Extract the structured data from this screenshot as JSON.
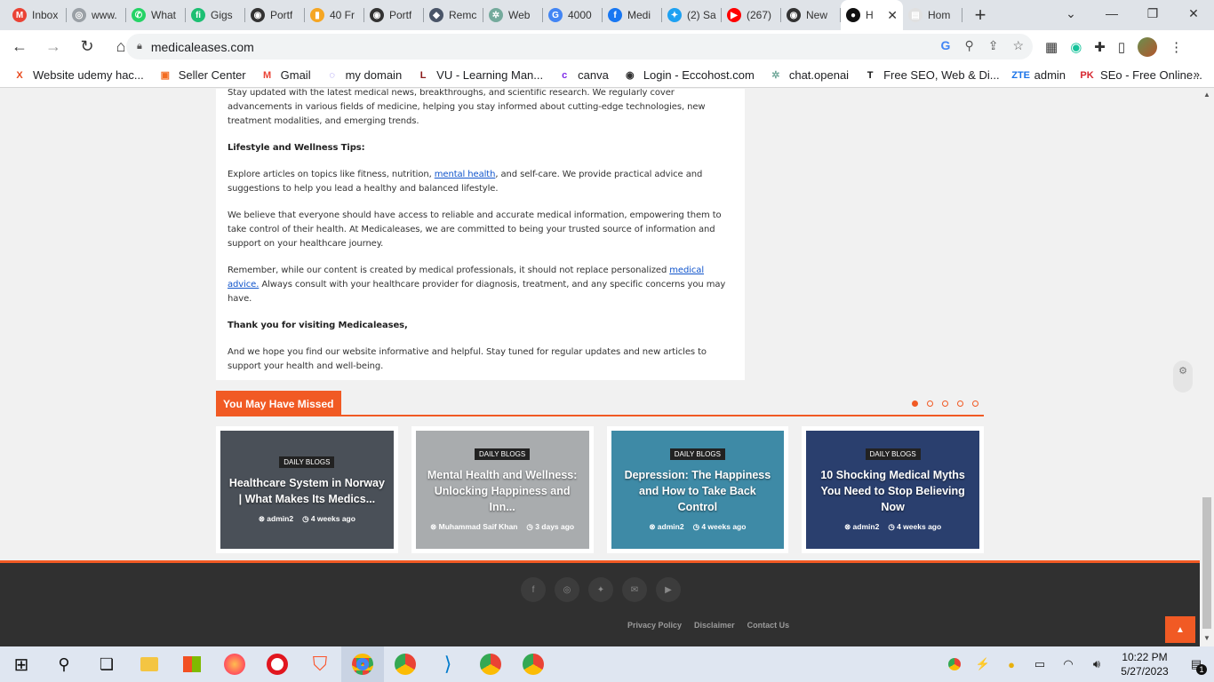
{
  "browser": {
    "tabs": [
      {
        "title": "Inbox",
        "icon": "gmail-icon",
        "color": "#ea4335",
        "glyph": "M"
      },
      {
        "title": "www.",
        "icon": "globe-icon",
        "color": "#9aa0a6",
        "glyph": "◎"
      },
      {
        "title": "What",
        "icon": "whatsapp-icon",
        "color": "#25d366",
        "glyph": "✆"
      },
      {
        "title": "Gigs",
        "icon": "fiverr-icon",
        "color": "#1dbf73",
        "glyph": "fi"
      },
      {
        "title": "Portf",
        "icon": "globe-icon",
        "color": "#333333",
        "glyph": "◉"
      },
      {
        "title": "40 Fr",
        "icon": "chart-icon",
        "color": "#f5a623",
        "glyph": "▮"
      },
      {
        "title": "Portf",
        "icon": "globe-icon",
        "color": "#333333",
        "glyph": "◉"
      },
      {
        "title": "Remc",
        "icon": "layers-icon",
        "color": "#4a5568",
        "glyph": "◆"
      },
      {
        "title": "Web",
        "icon": "openai-icon",
        "color": "#74aa9c",
        "glyph": "✲"
      },
      {
        "title": "4000",
        "icon": "google-icon",
        "color": "#4285f4",
        "glyph": "G"
      },
      {
        "title": "Medi",
        "icon": "facebook-icon",
        "color": "#1877f2",
        "glyph": "f"
      },
      {
        "title": "(2) Sa",
        "icon": "twitter-icon",
        "color": "#1da1f2",
        "glyph": "✦"
      },
      {
        "title": "(267)",
        "icon": "youtube-icon",
        "color": "#ff0000",
        "glyph": "▶"
      },
      {
        "title": "New",
        "icon": "chrome-icon",
        "color": "#333333",
        "glyph": "◉"
      },
      {
        "title": "H",
        "icon": "site-icon",
        "color": "#111111",
        "glyph": "●",
        "active": true
      },
      {
        "title": "Hom",
        "icon": "page-icon",
        "color": "#e0e0e0",
        "glyph": "▤"
      }
    ],
    "url": "medicaleases.com",
    "bookmarks": [
      {
        "label": "Website udemy hac...",
        "icon": "x-icon",
        "color": "#e8491d",
        "glyph": "X"
      },
      {
        "label": "Seller Center",
        "icon": "store-icon",
        "color": "#f36c21",
        "glyph": "▣"
      },
      {
        "label": "Gmail",
        "icon": "gmail-icon",
        "color": "#ea4335",
        "glyph": "M"
      },
      {
        "label": "my domain",
        "icon": "domain-icon",
        "color": "#7b68ee",
        "glyph": "◌"
      },
      {
        "label": "VU - Learning Man...",
        "icon": "lms-icon",
        "color": "#8b1a1a",
        "glyph": "L"
      },
      {
        "label": "canva",
        "icon": "canva-icon",
        "color": "#7d2ae8",
        "glyph": "c"
      },
      {
        "label": "Login - Eccohost.com",
        "icon": "globe-icon",
        "color": "#333333",
        "glyph": "◉"
      },
      {
        "label": "chat.openai",
        "icon": "openai-icon",
        "color": "#74aa9c",
        "glyph": "✲"
      },
      {
        "label": "Free SEO, Web & Di...",
        "icon": "t-icon",
        "color": "#111111",
        "glyph": "T"
      },
      {
        "label": "admin",
        "icon": "zte-icon",
        "color": "#1a73e8",
        "glyph": "ZTE"
      },
      {
        "label": "SEo - Free Online...",
        "icon": "pk-icon",
        "color": "#d6262f",
        "glyph": "PK"
      }
    ]
  },
  "article": {
    "p1": "Stay updated with the latest medical news, breakthroughs, and scientific research. We regularly cover advancements in various fields of medicine, helping you stay informed about cutting-edge technologies, new treatment modalities, and emerging trends.",
    "h_lifestyle": "Lifestyle and Wellness Tips:",
    "p2_before": "Explore articles on topics like fitness, nutrition, ",
    "p2_link": "mental health",
    "p2_after": ", and self-care. We provide practical advice and suggestions to help you lead a healthy and balanced lifestyle.",
    "p3": "We believe that everyone should have access to reliable and accurate medical information, empowering them to take control of their health. At Medicaleases, we are committed to being your trusted source of information and support on your healthcare journey.",
    "p4_before": "Remember, while our content is created by medical professionals, it should not replace personalized ",
    "p4_link": "medical advice.",
    "p4_after": " Always consult with your healthcare provider for diagnosis, treatment, and any specific concerns you may have.",
    "h_thanks": "Thank you for visiting Medicaleases,",
    "p5": "And we hope you find our website informative and helpful. Stay tuned for regular updates and new articles to support your health and well-being."
  },
  "missed": {
    "title": "You May Have Missed",
    "cards": [
      {
        "badge": "DAILY BLOGS",
        "title": "Healthcare System in Norway | What Makes Its Medics...",
        "author": "admin2",
        "date": "4 weeks ago",
        "bg": "#4a5058"
      },
      {
        "badge": "DAILY BLOGS",
        "title": "Mental Health and Wellness: Unlocking Happiness and Inn...",
        "author": "Muhammad Saif Khan",
        "date": "3 days ago",
        "bg": "#a9acae"
      },
      {
        "badge": "DAILY BLOGS",
        "title": "Depression: The Happiness and How to Take Back Control",
        "author": "admin2",
        "date": "4 weeks ago",
        "bg": "#3e8aa6"
      },
      {
        "badge": "DAILY BLOGS",
        "title": "10 Shocking Medical Myths You Need to Stop Believing Now",
        "author": "admin2",
        "date": "4 weeks ago",
        "bg": "#2a3f6e"
      }
    ]
  },
  "footer": {
    "social": [
      "f",
      "◎",
      "✦",
      "✉",
      "▶"
    ],
    "social_names": [
      "facebook-icon",
      "instagram-icon",
      "twitter-icon",
      "chat-icon",
      "youtube-icon"
    ],
    "links": [
      "Privacy Policy",
      "Disclaimer",
      "Contact Us"
    ]
  },
  "taskbar": {
    "time": "10:22 PM",
    "date": "5/27/2023",
    "notifications": "1"
  },
  "colors": {
    "accent": "#f15a24"
  }
}
